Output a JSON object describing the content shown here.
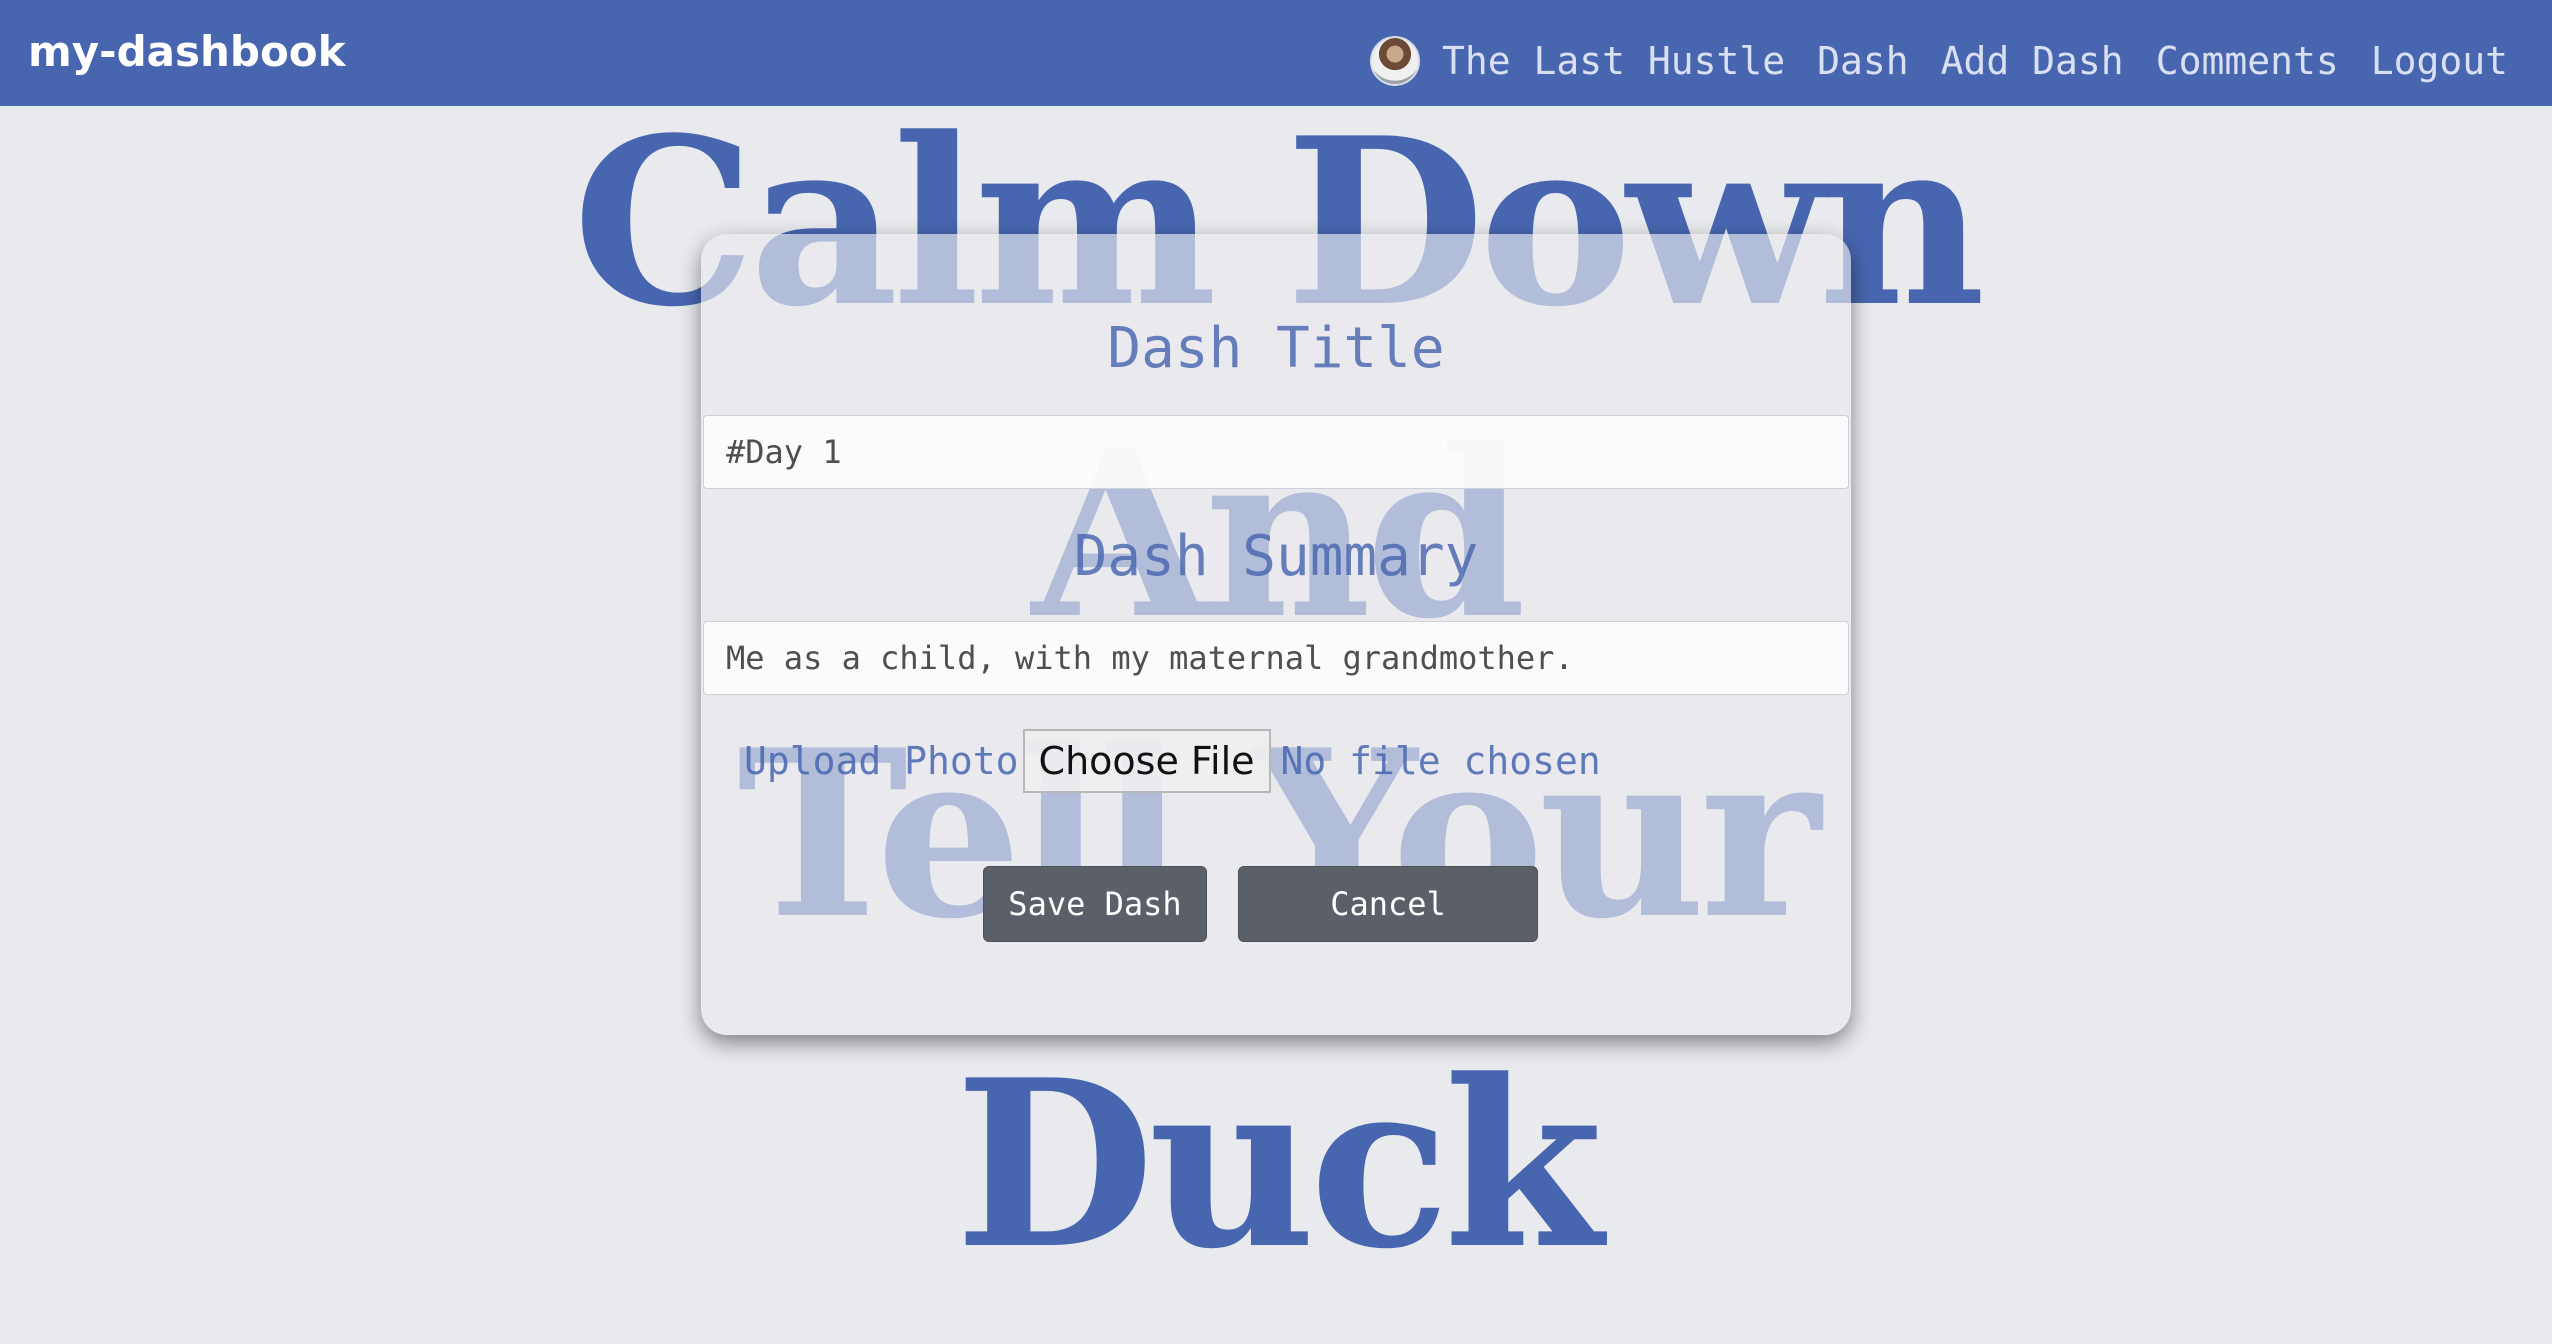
{
  "navbar": {
    "brand": "my-dashbook",
    "links": [
      "The Last Hustle",
      "Dash",
      "Add Dash",
      "Comments",
      "Logout"
    ]
  },
  "background_words": [
    "Calm Down",
    "And",
    "Tell Your",
    "Duck"
  ],
  "form": {
    "title_heading": "Dash Title",
    "title_value": "#Day 1",
    "summary_heading": "Dash Summary",
    "summary_value": "Me as a child, with my maternal grandmother.",
    "upload_label": "Upload Photo",
    "file_button": "Choose File",
    "file_status": "No file chosen",
    "save_label": "Save Dash",
    "cancel_label": "Cancel"
  },
  "colors": {
    "navbar": "#4866b0",
    "accent": "#4866b0",
    "background": "#e9eaee",
    "button": "#5b6068"
  },
  "icons": {
    "avatar": "user-avatar-photo"
  }
}
